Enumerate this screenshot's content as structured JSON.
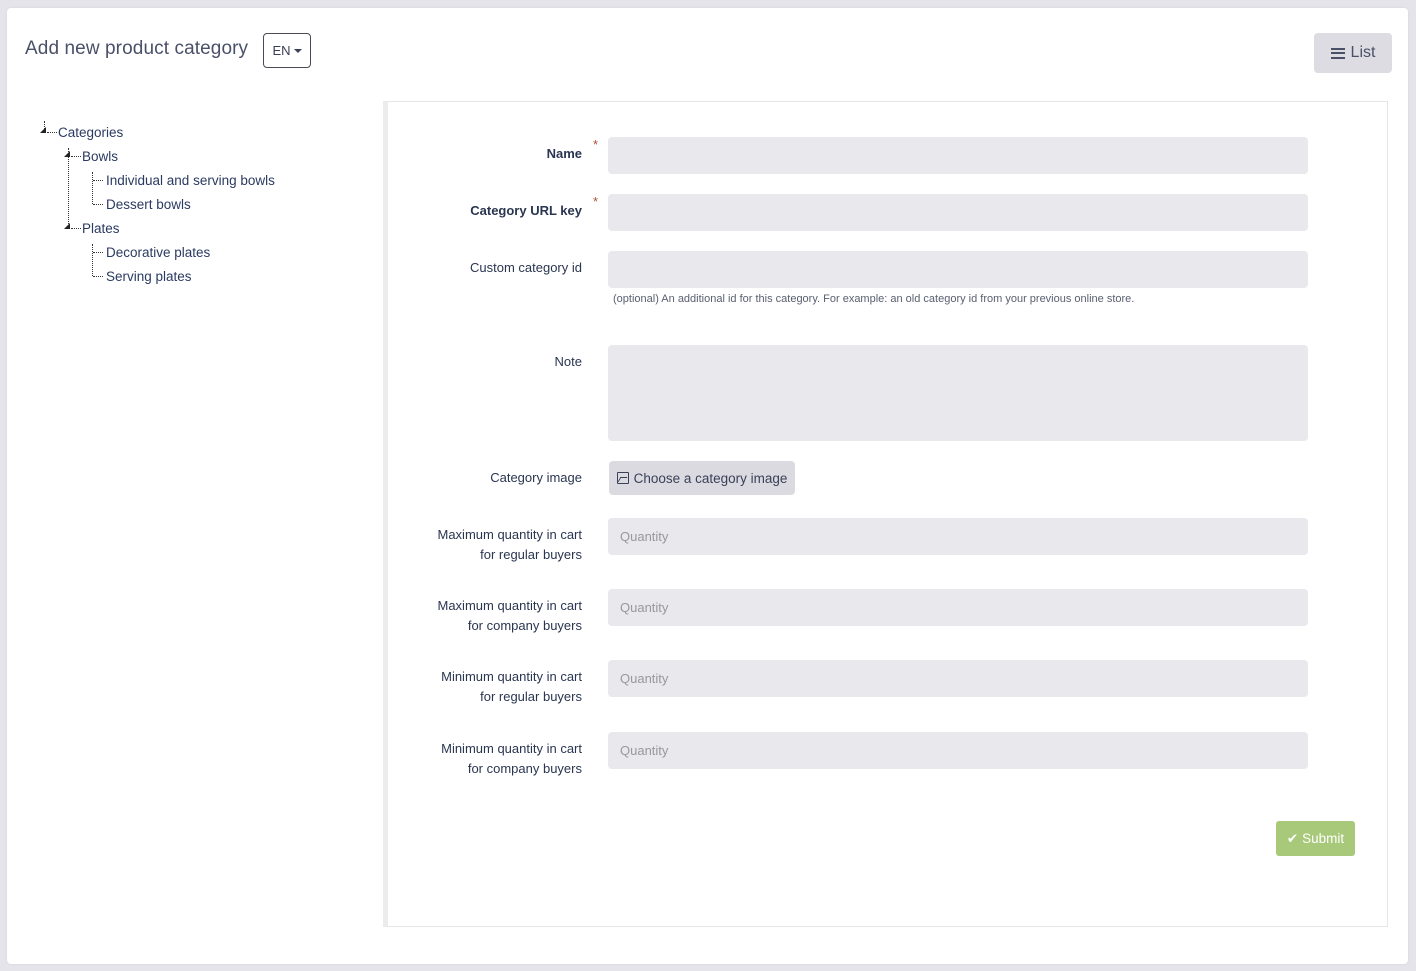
{
  "header": {
    "title": "Add new product category",
    "language": "EN",
    "list_button": "List"
  },
  "tree": {
    "root": "Categories",
    "groups": [
      {
        "label": "Bowls",
        "children": [
          "Individual and serving bowls",
          "Dessert bowls"
        ]
      },
      {
        "label": "Plates",
        "children": [
          "Decorative plates",
          "Serving plates"
        ]
      }
    ]
  },
  "form": {
    "name_label": "Name",
    "url_key_label": "Category URL key",
    "required_mark": "*",
    "custom_id_label": "Custom category id",
    "custom_id_help": "(optional) An additional id for this category. For example: an old category id from your previous online store.",
    "note_label": "Note",
    "image_label": "Category image",
    "image_button": "Choose a category image",
    "quantity_fields": [
      {
        "label_line1": "Maximum quantity in cart",
        "label_line2": "for regular buyers",
        "placeholder": "Quantity"
      },
      {
        "label_line1": "Maximum quantity in cart",
        "label_line2": "for company buyers",
        "placeholder": "Quantity"
      },
      {
        "label_line1": "Minimum quantity in cart",
        "label_line2": "for regular buyers",
        "placeholder": "Quantity"
      },
      {
        "label_line1": "Minimum quantity in cart",
        "label_line2": "for company buyers",
        "placeholder": "Quantity"
      }
    ],
    "submit_label": "Submit"
  },
  "colors": {
    "submit": "#a8c87a",
    "required": "#b05030",
    "input_bg": "#e8e8ed"
  }
}
